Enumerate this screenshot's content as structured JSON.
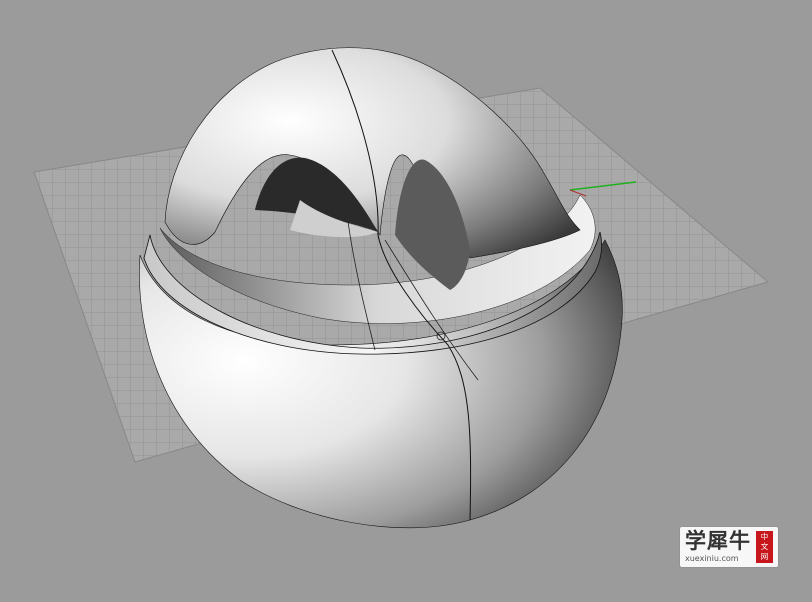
{
  "viewport": {
    "background": "#9b9b9b",
    "grid_color": "#8a8a8a",
    "grid_fill": "#a9a9a9",
    "axis_x_color": "#b03030",
    "axis_y_color": "#20b020",
    "model": "rendered-shell-bowl-with-cutaway-sphere"
  },
  "watermark": {
    "text": "学犀牛",
    "url": "xuexiniu.com",
    "seal_lines": [
      "中",
      "文",
      "网"
    ],
    "seal_color": "#c8161d"
  }
}
